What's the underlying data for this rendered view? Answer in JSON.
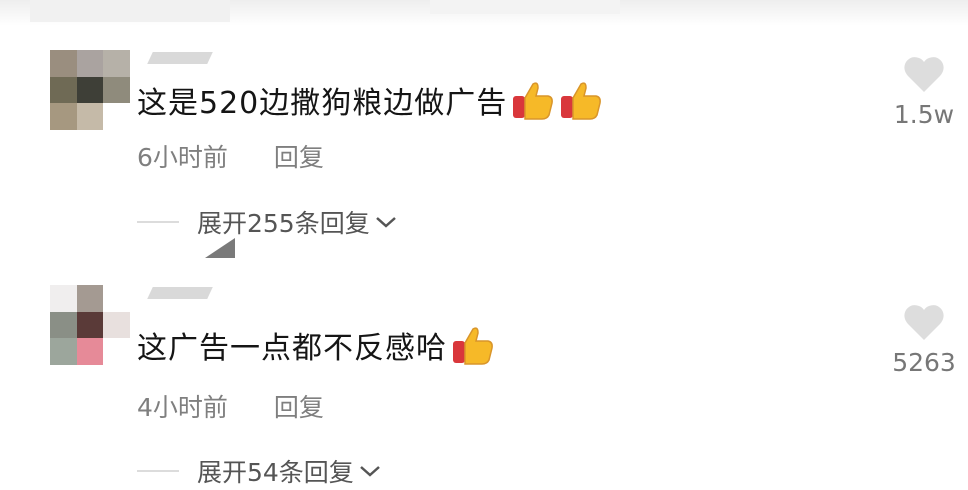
{
  "comments": [
    {
      "text": "这是520边撒狗粮边做广告",
      "emojis": [
        "thumbs-up-icon",
        "thumbs-up-icon"
      ],
      "time": "6小时前",
      "reply_label": "回复",
      "expand_label": "展开255条回复",
      "likes": "1.5w"
    },
    {
      "text": "这广告一点都不反感哈",
      "emojis": [
        "thumbs-up-icon"
      ],
      "time": "4小时前",
      "reply_label": "回复",
      "expand_label": "展开54条回复",
      "likes": "5263"
    }
  ],
  "colors": {
    "text": "#151515",
    "meta": "#7f7f7f",
    "heart": "#dddddd",
    "thumb_yellow": "#f6b928",
    "thumb_red": "#d9373b"
  }
}
